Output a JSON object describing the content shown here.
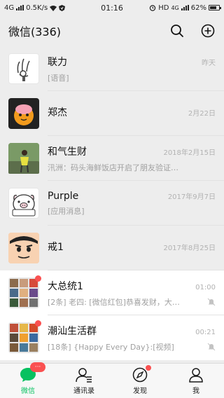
{
  "status_bar": {
    "network": "4G",
    "speed": "0.5K/s",
    "time": "01:16",
    "hd": "HD",
    "network2": "4G",
    "battery": "62%"
  },
  "header": {
    "title": "微信(336)",
    "search_icon": "search-icon",
    "add_icon": "plus-circle-icon"
  },
  "chats": [
    {
      "name": "联力",
      "preview": "[语音]",
      "time": "昨天",
      "pinned": true
    },
    {
      "name": "郑杰",
      "preview": "",
      "time": "2月22日",
      "pinned": true
    },
    {
      "name": "和气生财",
      "preview": "汛洲：码头海鲜饭店开启了朋友验证…",
      "time": "2018年2月15日",
      "pinned": true
    },
    {
      "name": "Purple",
      "preview": "[应用消息]",
      "time": "2017年9月7日",
      "pinned": true
    },
    {
      "name": "戒1",
      "preview": "",
      "time": "2017年8月25日",
      "pinned": true
    },
    {
      "name": "大总统1",
      "preview": "[2条] 老四: [微信红包]恭喜发财，大…",
      "time": "01:00",
      "pinned": false,
      "muted": true,
      "unread_dot": true
    },
    {
      "name": "潮汕生活群",
      "preview": "[18条] {Happy Every Day}:[视频]",
      "time": "00:21",
      "pinned": false,
      "muted": true,
      "unread_dot": true
    }
  ],
  "tabbar": {
    "tabs": [
      {
        "label": "微信",
        "icon": "chat-bubble-icon",
        "badge": "···",
        "active": true
      },
      {
        "label": "通讯录",
        "icon": "contacts-icon"
      },
      {
        "label": "发现",
        "icon": "compass-icon",
        "dot": true
      },
      {
        "label": "我",
        "icon": "person-icon"
      }
    ]
  },
  "colors": {
    "accent": "#07c160",
    "badge": "#fa5151",
    "background": "#ededed"
  }
}
